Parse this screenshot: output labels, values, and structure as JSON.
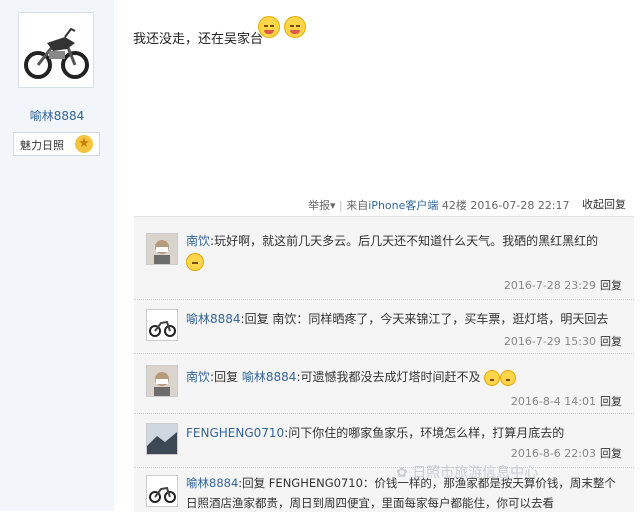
{
  "author": {
    "username": "喻林8884",
    "medal_label": "魅力日照"
  },
  "post": {
    "text": "我还没走，还在吴家台"
  },
  "post_meta": {
    "report": "举报",
    "separator": "|",
    "source_prefix": "来自",
    "source_link": "iPhone客户端",
    "floor": "42楼",
    "datetime": "2016-07-28 22:17",
    "collapse_label": "收起回复"
  },
  "replies": [
    {
      "name": "南饮",
      "separator": ":",
      "text": "玩好啊，就这前几天多云。后几天还不知道什么天气。我硒的黑红黑红的",
      "time": "2016-7-28 23:29",
      "reply_label": "回复"
    },
    {
      "name": "喻林8884",
      "separator": ":",
      "text": "回复 南饮：同样晒疼了，今天来锦江了，买车票，逛灯塔，明天回去",
      "time": "2016-7-29 15:30",
      "reply_label": "回复"
    },
    {
      "name": "南饮",
      "separator": ":",
      "prefix": "回复",
      "target": "喻林8884",
      "text": "可遗憾我都没去成灯塔时间赶不及",
      "time": "2016-8-4 14:01",
      "reply_label": "回复"
    },
    {
      "name": "FENGHENG0710",
      "separator": ":",
      "text": "问下你住的哪家鱼家乐，环境怎么样，打算月底去的",
      "time": "2016-8-6 22:03",
      "reply_label": "回复"
    },
    {
      "name": "喻林8884",
      "separator": ":",
      "text": "回复 FENGHENG0710：价钱一样的，那渔家都是按天算价钱，周末整个日照酒店渔家都贵，周日到周四便宜，里面每家每户都能住，你可以去看"
    }
  ],
  "watermark": "日照市旅游信息中心"
}
